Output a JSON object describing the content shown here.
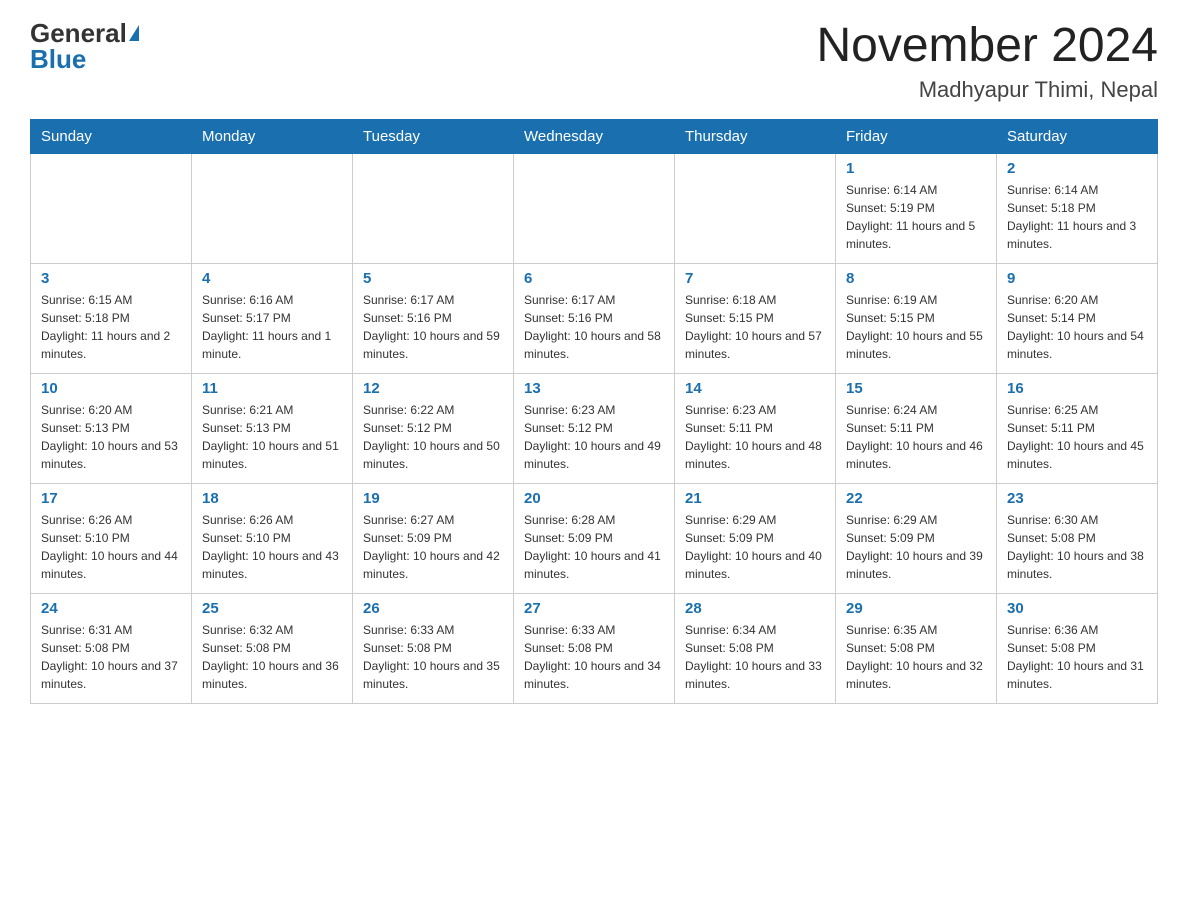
{
  "header": {
    "logo_general": "General",
    "logo_blue": "Blue",
    "month_year": "November 2024",
    "location": "Madhyapur Thimi, Nepal"
  },
  "weekdays": [
    "Sunday",
    "Monday",
    "Tuesday",
    "Wednesday",
    "Thursday",
    "Friday",
    "Saturday"
  ],
  "weeks": [
    [
      {
        "day": "",
        "info": ""
      },
      {
        "day": "",
        "info": ""
      },
      {
        "day": "",
        "info": ""
      },
      {
        "day": "",
        "info": ""
      },
      {
        "day": "",
        "info": ""
      },
      {
        "day": "1",
        "info": "Sunrise: 6:14 AM\nSunset: 5:19 PM\nDaylight: 11 hours and 5 minutes."
      },
      {
        "day": "2",
        "info": "Sunrise: 6:14 AM\nSunset: 5:18 PM\nDaylight: 11 hours and 3 minutes."
      }
    ],
    [
      {
        "day": "3",
        "info": "Sunrise: 6:15 AM\nSunset: 5:18 PM\nDaylight: 11 hours and 2 minutes."
      },
      {
        "day": "4",
        "info": "Sunrise: 6:16 AM\nSunset: 5:17 PM\nDaylight: 11 hours and 1 minute."
      },
      {
        "day": "5",
        "info": "Sunrise: 6:17 AM\nSunset: 5:16 PM\nDaylight: 10 hours and 59 minutes."
      },
      {
        "day": "6",
        "info": "Sunrise: 6:17 AM\nSunset: 5:16 PM\nDaylight: 10 hours and 58 minutes."
      },
      {
        "day": "7",
        "info": "Sunrise: 6:18 AM\nSunset: 5:15 PM\nDaylight: 10 hours and 57 minutes."
      },
      {
        "day": "8",
        "info": "Sunrise: 6:19 AM\nSunset: 5:15 PM\nDaylight: 10 hours and 55 minutes."
      },
      {
        "day": "9",
        "info": "Sunrise: 6:20 AM\nSunset: 5:14 PM\nDaylight: 10 hours and 54 minutes."
      }
    ],
    [
      {
        "day": "10",
        "info": "Sunrise: 6:20 AM\nSunset: 5:13 PM\nDaylight: 10 hours and 53 minutes."
      },
      {
        "day": "11",
        "info": "Sunrise: 6:21 AM\nSunset: 5:13 PM\nDaylight: 10 hours and 51 minutes."
      },
      {
        "day": "12",
        "info": "Sunrise: 6:22 AM\nSunset: 5:12 PM\nDaylight: 10 hours and 50 minutes."
      },
      {
        "day": "13",
        "info": "Sunrise: 6:23 AM\nSunset: 5:12 PM\nDaylight: 10 hours and 49 minutes."
      },
      {
        "day": "14",
        "info": "Sunrise: 6:23 AM\nSunset: 5:11 PM\nDaylight: 10 hours and 48 minutes."
      },
      {
        "day": "15",
        "info": "Sunrise: 6:24 AM\nSunset: 5:11 PM\nDaylight: 10 hours and 46 minutes."
      },
      {
        "day": "16",
        "info": "Sunrise: 6:25 AM\nSunset: 5:11 PM\nDaylight: 10 hours and 45 minutes."
      }
    ],
    [
      {
        "day": "17",
        "info": "Sunrise: 6:26 AM\nSunset: 5:10 PM\nDaylight: 10 hours and 44 minutes."
      },
      {
        "day": "18",
        "info": "Sunrise: 6:26 AM\nSunset: 5:10 PM\nDaylight: 10 hours and 43 minutes."
      },
      {
        "day": "19",
        "info": "Sunrise: 6:27 AM\nSunset: 5:09 PM\nDaylight: 10 hours and 42 minutes."
      },
      {
        "day": "20",
        "info": "Sunrise: 6:28 AM\nSunset: 5:09 PM\nDaylight: 10 hours and 41 minutes."
      },
      {
        "day": "21",
        "info": "Sunrise: 6:29 AM\nSunset: 5:09 PM\nDaylight: 10 hours and 40 minutes."
      },
      {
        "day": "22",
        "info": "Sunrise: 6:29 AM\nSunset: 5:09 PM\nDaylight: 10 hours and 39 minutes."
      },
      {
        "day": "23",
        "info": "Sunrise: 6:30 AM\nSunset: 5:08 PM\nDaylight: 10 hours and 38 minutes."
      }
    ],
    [
      {
        "day": "24",
        "info": "Sunrise: 6:31 AM\nSunset: 5:08 PM\nDaylight: 10 hours and 37 minutes."
      },
      {
        "day": "25",
        "info": "Sunrise: 6:32 AM\nSunset: 5:08 PM\nDaylight: 10 hours and 36 minutes."
      },
      {
        "day": "26",
        "info": "Sunrise: 6:33 AM\nSunset: 5:08 PM\nDaylight: 10 hours and 35 minutes."
      },
      {
        "day": "27",
        "info": "Sunrise: 6:33 AM\nSunset: 5:08 PM\nDaylight: 10 hours and 34 minutes."
      },
      {
        "day": "28",
        "info": "Sunrise: 6:34 AM\nSunset: 5:08 PM\nDaylight: 10 hours and 33 minutes."
      },
      {
        "day": "29",
        "info": "Sunrise: 6:35 AM\nSunset: 5:08 PM\nDaylight: 10 hours and 32 minutes."
      },
      {
        "day": "30",
        "info": "Sunrise: 6:36 AM\nSunset: 5:08 PM\nDaylight: 10 hours and 31 minutes."
      }
    ]
  ]
}
